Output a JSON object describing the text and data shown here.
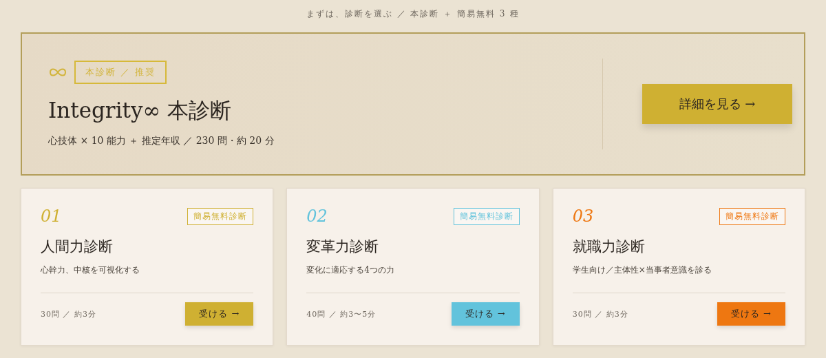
{
  "caption": "まずは、診断を選ぶ ／ 本診断 ＋ 簡易無料 3 種",
  "hero": {
    "badge": "本診断 ／ 推奨",
    "title": "Integrity∞ 本診断",
    "subtitle": "心技体 × 10 能力 ＋ 推定年収 ／ 230 問・約 20 分",
    "button": "詳細を見る →"
  },
  "cards": [
    {
      "number": "01",
      "badge": "簡易無料診断",
      "title": "人間力診断",
      "description": "心幹力、中核を可視化する",
      "meta": "30問 ／ 約3分",
      "button": "受ける →",
      "color": "#cfb032"
    },
    {
      "number": "02",
      "badge": "簡易無料診断",
      "title": "変革力診断",
      "description": "変化に適応する4つの力",
      "meta": "40問 ／ 約3〜5分",
      "button": "受ける →",
      "color": "#62c3dc"
    },
    {
      "number": "03",
      "badge": "簡易無料診断",
      "title": "就職力診断",
      "description": "学生向け／主体性×当事者意識を診る",
      "meta": "30問 ／ 約3分",
      "button": "受ける →",
      "color": "#ee7711"
    }
  ]
}
